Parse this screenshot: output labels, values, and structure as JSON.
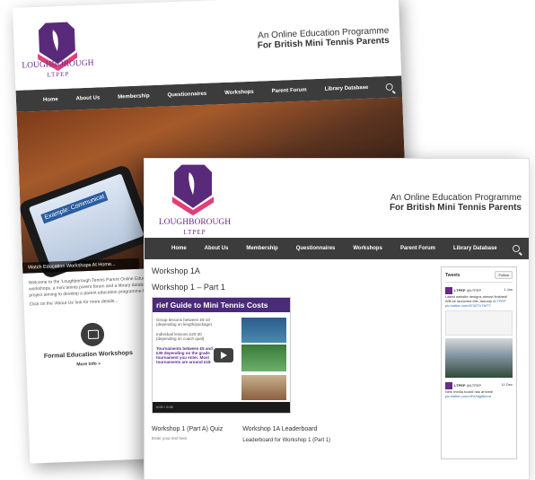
{
  "brand": {
    "name": "LOUGHBOROUGH",
    "sub": "LTPEP",
    "tagline_1": "An Online Education Programme",
    "tagline_2": "For British Mini Tennis Parents",
    "colors": {
      "purple": "#6a2a8a",
      "pink": "#e0407a",
      "nav": "#3c3c3c"
    }
  },
  "nav": {
    "items": [
      "Home",
      "About Us",
      "Membership",
      "Questionnaires",
      "Workshops",
      "Parent Forum",
      "Library Database"
    ],
    "search_icon": "search-icon"
  },
  "back_window": {
    "hero_caption": "Watch Education Workshops At Home...",
    "tablet_text": "Example: Communicat",
    "intro_1": "Welcome to the 'Loughborough Tennis Parent Online Educatio workshops, a mini tennis parent forum and a library database project aiming to develop a parent education programme for B",
    "intro_2": "Click on the 'About Us' link for more details...",
    "feature_icon": "monitor-icon",
    "feature_title": "Formal Education Workshops",
    "feature_more": "More Info »"
  },
  "front_window": {
    "page_title": "Workshop 1A",
    "subtitle": "Workshop 1 – Part 1",
    "video": {
      "banner": "rief Guide to Mini Tennis Costs",
      "bullets": [
        "Group lessons between £5-10 (depending on length/package)",
        "Individual lessons £20-30 (depending on coach qual)",
        "Tournaments between £5 and £35 depending on the grade tournament you enter. Most tournaments are around £18"
      ],
      "time": "0:00 / 0:00"
    },
    "quiz_title": "Workshop 1 (Part A) Quiz",
    "quiz_sub": "Enter your text here",
    "leaderboard_title": "Workshop 1A Leaderboard",
    "leaderboard_sub": "Leaderboard for Workshop 1 (Part 1)",
    "tweets": {
      "title": "Tweets",
      "follow": "Follow",
      "items": [
        {
          "user": "LTPEP",
          "handle": "@LTPEP",
          "date": "1 Jan",
          "text": "Latest website designs almost finished! Will be launched this January",
          "tag": "#LTPEP",
          "link": "pic.twitter.com/8740TV7MT7"
        },
        {
          "user": "LTPEP",
          "handle": "@LTPEP",
          "date": "11 Dec",
          "text": "New media board has arrived!",
          "link": "pic.twitter.com/nFe9dgl8mmt"
        }
      ]
    }
  }
}
